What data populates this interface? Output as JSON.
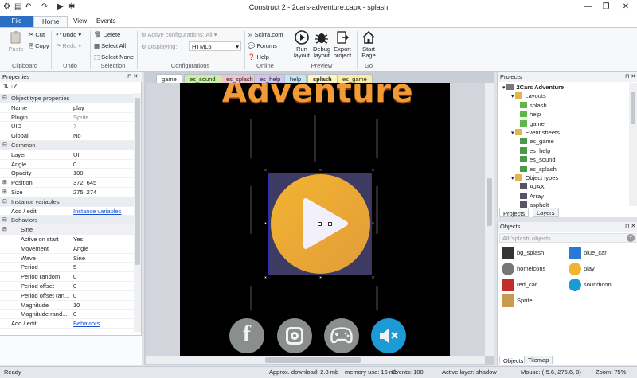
{
  "window": {
    "title": "Construct 2 - 2cars-adventure.capx - splash"
  },
  "ribbon_tabs": [
    "File",
    "Home",
    "View",
    "Events"
  ],
  "ribbon": {
    "clipboard": {
      "paste": "Paste",
      "cut": "Cut",
      "copy": "Copy",
      "label": "Clipboard"
    },
    "undo": {
      "undo": "Undo",
      "redo": "Redo",
      "label": "Undo"
    },
    "selection": {
      "delete": "Delete",
      "select_all": "Select All",
      "select_none": "Select None",
      "label": "Selection"
    },
    "configurations": {
      "active": "Active configurations: All",
      "displaying_label": "Displaying:",
      "displaying_value": "HTML5",
      "label": "Configurations"
    },
    "online": {
      "scirra": "Scirra.com",
      "forums": "Forums",
      "help": "Help",
      "label": "Online"
    },
    "preview": {
      "run": "Run layout",
      "debug": "Debug layout",
      "export": "Export project",
      "label": "Preview"
    },
    "go": {
      "start": "Start Page",
      "label": "Go"
    }
  },
  "properties": {
    "title": "Properties",
    "rows": [
      {
        "type": "sec",
        "k": "Object type properties"
      },
      {
        "k": "Name",
        "v": "play"
      },
      {
        "k": "Plugin",
        "v": "Sprite",
        "grey": true
      },
      {
        "k": "UID",
        "v": "7",
        "grey": true
      },
      {
        "k": "Global",
        "v": "No"
      },
      {
        "type": "sec",
        "k": "Common"
      },
      {
        "k": "Layer",
        "v": "UI"
      },
      {
        "k": "Angle",
        "v": "0"
      },
      {
        "k": "Opacity",
        "v": "100"
      },
      {
        "k": "Position",
        "v": "372, 645",
        "exp": true
      },
      {
        "k": "Size",
        "v": "275, 274",
        "exp": true
      },
      {
        "type": "sec",
        "k": "Instance variables"
      },
      {
        "k": "Add / edit",
        "v": "Instance variables",
        "link": true
      },
      {
        "type": "sec",
        "k": "Behaviors"
      },
      {
        "type": "sub",
        "k": "Sine"
      },
      {
        "k": "Active on start",
        "v": "Yes",
        "indent": true
      },
      {
        "k": "Movement",
        "v": "Angle",
        "indent": true
      },
      {
        "k": "Wave",
        "v": "Sine",
        "indent": true
      },
      {
        "k": "Period",
        "v": "5",
        "indent": true
      },
      {
        "k": "Period random",
        "v": "0",
        "indent": true
      },
      {
        "k": "Period offset",
        "v": "0",
        "indent": true
      },
      {
        "k": "Period offset ran...",
        "v": "0",
        "indent": true
      },
      {
        "k": "Magnitude",
        "v": "10",
        "indent": true
      },
      {
        "k": "Magnitude rand...",
        "v": "0",
        "indent": true
      },
      {
        "k": "Add / edit",
        "v": "Behaviors",
        "link": true
      }
    ]
  },
  "doc_tabs": [
    {
      "label": "game",
      "color": "#fff"
    },
    {
      "label": "es_sound",
      "color": "#c9f0a5"
    },
    {
      "label": "es_splash",
      "color": "#f6c2d0"
    },
    {
      "label": "es_help",
      "color": "#d4c5f0"
    },
    {
      "label": "help",
      "color": "#c4e7f7"
    },
    {
      "label": "splash",
      "color": "#fff6c4",
      "active": true
    },
    {
      "label": "es_game",
      "color": "#f8efa4"
    }
  ],
  "game": {
    "heading": "Adventure"
  },
  "projects": {
    "title": "Projects",
    "root": "2Cars Adventure",
    "layouts_label": "Layouts",
    "layouts": [
      "splash",
      "help",
      "game"
    ],
    "events_label": "Event sheets",
    "events": [
      "es_game",
      "es_help",
      "es_sound",
      "es_splash"
    ],
    "types_label": "Object types",
    "types": [
      "AJAX",
      "Array",
      "asphalt"
    ],
    "tabs": [
      "Projects",
      "Layers"
    ]
  },
  "objects": {
    "title": "Objects",
    "filter": "All 'splash' objects",
    "items": [
      {
        "name": "bg_splash",
        "color": "#333"
      },
      {
        "name": "blue_car",
        "color": "#2a7ad5"
      },
      {
        "name": "homeicons",
        "color": "#777"
      },
      {
        "name": "play",
        "color": "#f2b430"
      },
      {
        "name": "red_car",
        "color": "#c42b2b"
      },
      {
        "name": "soundIcon",
        "color": "#1b9ad6"
      },
      {
        "name": "Sprite",
        "color": "#c89a50"
      }
    ],
    "tabs": [
      "Objects",
      "Tilemap"
    ]
  },
  "status": {
    "ready": "Ready",
    "download": "Approx. download: 2.8 mb",
    "memory": "memory use: 16 mb",
    "events": "Events: 100",
    "layer": "Active layer: shadow",
    "mouse": "Mouse: (-5.6, 275.6, 0)",
    "zoom": "Zoom: 75%"
  },
  "colors": {
    "accent": "#2b6fc5",
    "play_yellow": "#f2b430",
    "play_orange": "#e39c3a",
    "sound_blue": "#1b9ad6",
    "icon_grey": "#8a8f8e"
  }
}
